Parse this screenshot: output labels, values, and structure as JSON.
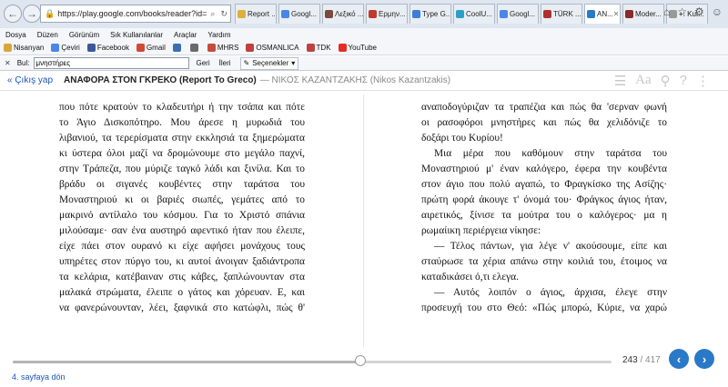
{
  "browser": {
    "url": "https://play.google.com/books/reader?id=kK0ICA",
    "tabs": [
      {
        "label": "Report ...",
        "color": "#d9b13b"
      },
      {
        "label": "Googl...",
        "color": "#4a86e8"
      },
      {
        "label": "Λεξικό ...",
        "color": "#7a4a3a"
      },
      {
        "label": "Ερμην...",
        "color": "#c0392b"
      },
      {
        "label": "Type G...",
        "color": "#3b7dd8"
      },
      {
        "label": "CoolU...",
        "color": "#2aa0c8"
      },
      {
        "label": "Googl...",
        "color": "#4a86e8"
      },
      {
        "label": "TÜRK ...",
        "color": "#b03030"
      },
      {
        "label": "AN...",
        "color": "#2a79c8"
      },
      {
        "label": "Moder...",
        "color": "#8a2a2a"
      },
      {
        "label": "+: Kut...",
        "color": "#999999"
      }
    ]
  },
  "menu": [
    "Dosya",
    "Düzen",
    "Görünüm",
    "Sık Kullanılanlar",
    "Araçlar",
    "Yardım"
  ],
  "bookmarks": [
    {
      "label": "Nisanyan",
      "color": "#d9a63b"
    },
    {
      "label": "Çeviri",
      "color": "#4a86e8"
    },
    {
      "label": "Facebook",
      "color": "#3b5998"
    },
    {
      "label": "Gmail",
      "color": "#d14836"
    },
    {
      "label": "",
      "color": "#3a6fb0"
    },
    {
      "label": "",
      "color": "#6a6a6a"
    },
    {
      "label": "MHRS",
      "color": "#c84a3a"
    },
    {
      "label": "OSMANLICA",
      "color": "#c04040"
    },
    {
      "label": "TDK",
      "color": "#c04040"
    },
    {
      "label": "YouTube",
      "color": "#e52d27"
    }
  ],
  "findbar": {
    "label": "Bul:",
    "value": "μνηστήρες",
    "prev": "Geri",
    "next": "İleri",
    "options": "Seçenekler"
  },
  "reader": {
    "back_link": "« Çıkış yap",
    "title": "ΑΝΑΦΟΡΑ ΣΤΟΝ ΓΚΡΕΚΟ (Report To Greco)",
    "author": "— ΝΙΚΟΣ ΚΑΖΑΝΤΖΑΚΗΣ (Nikos Kazantzakis)",
    "left_page": [
      "που πότε κρατούν το κλαδευτήρι ή την τσάπα και πότε",
      "το Άγιο Δισκοπότηρο. Μου άρεσε η μυρωδιά του",
      "λιβανιού, τα τερερίσματα στην εκκλησιά τα ξημερώματα",
      "κι ύστερα όλοι μαζί να δρομώνουμε στο μεγάλο παχνί,",
      "στην Τράπεζα, που μύριζε ταγκό λάδι και ξινίλα. Και το",
      "βράδυ οι σιγανές κουβέντες στην ταράτσα του",
      "Μοναστηριού κι οι βαριές σιωπές, γεμάτες από το",
      "μακρινό αντίλαλο του κόσμου. Για το Χριστό σπάνια",
      "μιλούσαμε· σαν ένα αυστηρό αφεντικό ήταν που έλειπε,",
      "είχε πάει στον ουρανό κι είχε αφήσει μονάχους τους",
      "υπηρέτες στον πύργο του, κι αυτοί άνοιγαν ξαδιάντροπα",
      "τα κελάρια, κατέβαιναν στις κάβες, ξαπλώνουνταν στα",
      "μαλακά στρώματα, έλειπε ο γάτος και χόρευαν. Ε, και",
      "να φανερώνουνταν, λέει, ξαφνικά στο κατώφλι, πώς θ'"
    ],
    "right_page": [
      "αναποδογύριζαν τα τραπέζια και πώς θα 'σερναν φωνή",
      "οι ρασοφόροι μνηστήρες και πώς θα χελιδόνιζε το",
      "δοξάρι του Κυρίου!",
      "Μια μέρα που καθόμουν στην ταράτσα του",
      "Μοναστηριού μ' έναν καλόγερο, έφερα την κουβέντα",
      "στον άγιο που πολύ αγαπώ, το Φραγκίσκο της Ασίζης·",
      "πρώτη φορά άκουγε τ' όνομά του· Φράγκος άγιος ήταν,",
      "αιρετικός, ξίνισε τα μούτρα του ο καλόγερος· μα η",
      "ρωμαίικη περιέργεια νίκησε:",
      "— Τέλος πάντων, για λέγε ν' ακούσουμε, είπε και",
      "σταύρωσε τα χέρια απάνω στην κοιλιά του, έτοιμος να",
      "καταδικάσει ό,τι ελεγα.",
      "— Αυτός λοιπόν ο άγιος, άρχισα, έλεγε στην",
      "προσευχή του στο Θεό: «Πώς μπορώ, Κύριε, να χαρώ"
    ]
  },
  "pager": {
    "current": "243",
    "total": "/ 417",
    "progress": 0.58,
    "goto_link": "4. sayfaya dön"
  }
}
